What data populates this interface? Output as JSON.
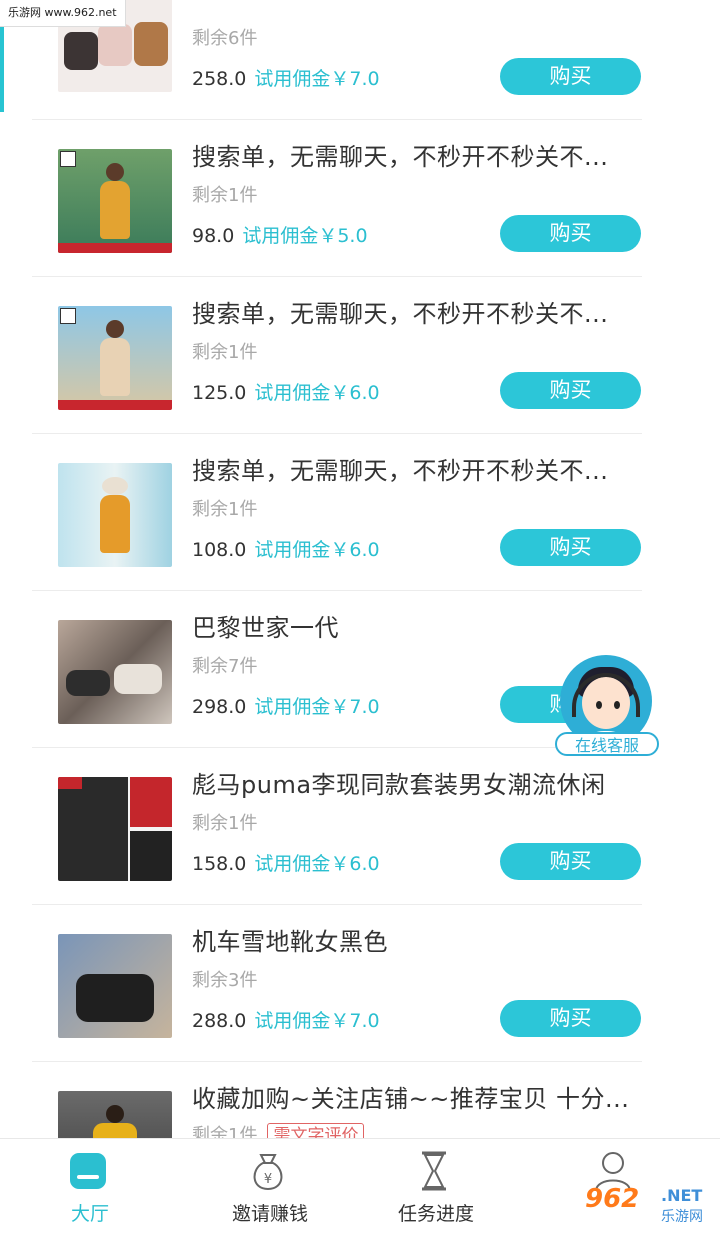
{
  "watermark": {
    "top_left": "乐游网 www.962.net",
    "logo": "962",
    "site": ".NET",
    "sub": "乐游网"
  },
  "items": [
    {
      "title": "",
      "remain": "剩余6件",
      "price": "258.0",
      "commission": "试用佣金￥7.0",
      "buy": "购买",
      "thumb": "boots"
    },
    {
      "title": "搜索单，无需聊天，不秒开不秒关不...",
      "remain": "剩余1件",
      "price": "98.0",
      "commission": "试用佣金￥5.0",
      "buy": "购买",
      "thumb": "dress-yellow"
    },
    {
      "title": "搜索单，无需聊天，不秒开不秒关不...",
      "remain": "剩余1件",
      "price": "125.0",
      "commission": "试用佣金￥6.0",
      "buy": "购买",
      "thumb": "dress-beige"
    },
    {
      "title": "搜索单，无需聊天，不秒开不秒关不...",
      "remain": "剩余1件",
      "price": "108.0",
      "commission": "试用佣金￥6.0",
      "buy": "购买",
      "thumb": "dress-orange"
    },
    {
      "title": "巴黎世家一代",
      "remain": "剩余7件",
      "price": "298.0",
      "commission": "试用佣金￥7.0",
      "buy": "购买",
      "thumb": "sneakers"
    },
    {
      "title": "彪马puma李现同款套装男女潮流休闲",
      "remain": "剩余1件",
      "price": "158.0",
      "commission": "试用佣金￥6.0",
      "buy": "购买",
      "thumb": "tracksuit"
    },
    {
      "title": "机车雪地靴女黑色",
      "remain": "剩余3件",
      "price": "288.0",
      "commission": "试用佣金￥7.0",
      "buy": "购买",
      "thumb": "snow-boots"
    },
    {
      "title": "收藏加购~关注店铺~~推荐宝贝 十分...",
      "remain": "剩余1件",
      "tag": "需文字评价",
      "thumb": "jacket"
    }
  ],
  "customer_service": {
    "label": "在线客服"
  },
  "tabs": [
    {
      "label": "大厅",
      "icon": "hall-icon",
      "active": true
    },
    {
      "label": "邀请赚钱",
      "icon": "money-bag-icon",
      "active": false
    },
    {
      "label": "任务进度",
      "icon": "hourglass-icon",
      "active": false
    },
    {
      "label": "",
      "icon": "profile-icon",
      "active": false
    }
  ],
  "colors": {
    "accent": "#2cc6d8",
    "price": "#333333",
    "muted": "#a8a8a8",
    "tag_red": "#e06464"
  }
}
